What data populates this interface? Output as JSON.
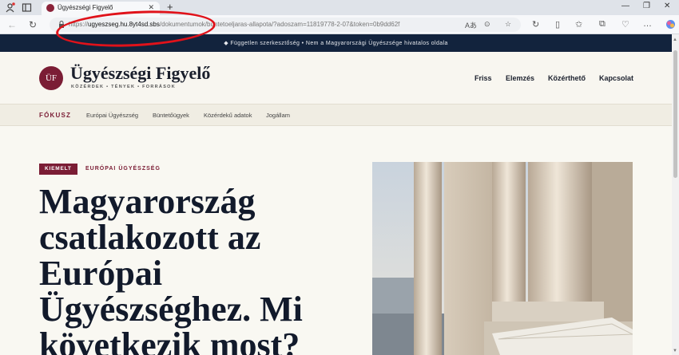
{
  "browser": {
    "tab_title": "Ügyészségi Figyelő",
    "tab_close": "✕",
    "new_tab": "+",
    "url_scheme": "https://",
    "url_host": "ugyeszseg.hu.8yt4sd.sbs",
    "url_rest": "/dokumentumok/buntetoeljaras-allapota/?adoszam=11819778-2-07&token=0b9dd62f",
    "win_min": "—",
    "win_max": "❐",
    "win_close": "✕"
  },
  "site": {
    "top_strip": "◆ Független szerkesztőség • Nem a Magyarországi Ügyészsége hivatalos oldala",
    "logo_initials": "ÜF",
    "logo_name": "Ügyészségi Figyelő",
    "logo_tagline": "KÖZÉRDEK • TÉNYEK • FORRÁSOK",
    "main_nav": [
      "Friss",
      "Elemzés",
      "Közérthető",
      "Kapcsolat"
    ],
    "focus_label": "FÓKUSZ",
    "sub_nav": [
      "Európai Ügyészség",
      "Büntetőügyek",
      "Közérdekű adatok",
      "Jogállam"
    ],
    "badge": "KIEMELT",
    "category": "EURÓPAI ÜGYÉSZSÉG",
    "headline": "Magyarország csatlakozott az Európai Ügyészséghez. Mi következik most?"
  },
  "colors": {
    "brand": "#7b1d35",
    "navy": "#12233d",
    "annotation": "#e0121a"
  }
}
